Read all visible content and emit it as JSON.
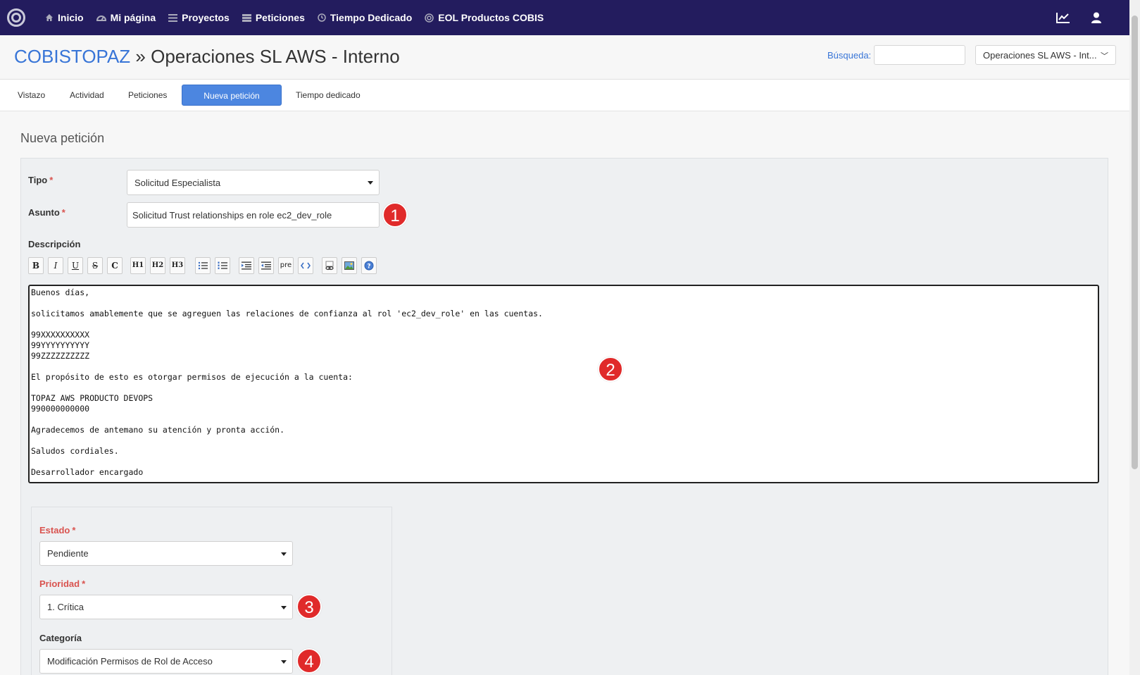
{
  "nav": {
    "items": [
      {
        "label": "Inicio",
        "icon": "home-icon"
      },
      {
        "label": "Mi página",
        "icon": "dashboard-icon"
      },
      {
        "label": "Proyectos",
        "icon": "list-icon"
      },
      {
        "label": "Peticiones",
        "icon": "issues-icon"
      },
      {
        "label": "Tiempo Dedicado",
        "icon": "clock-icon"
      },
      {
        "label": "EOL Productos COBIS",
        "icon": "globe-icon"
      }
    ]
  },
  "header": {
    "project_link": "COBISTOPAZ",
    "separator": " » ",
    "project_name": "Operaciones SL AWS - Interno",
    "search_label": "Búsqueda:",
    "search_value": "",
    "project_select": "Operaciones SL AWS - Int..."
  },
  "tabs": [
    {
      "label": "Vistazo"
    },
    {
      "label": "Actividad"
    },
    {
      "label": "Peticiones"
    },
    {
      "label": "Nueva petición",
      "active": true
    },
    {
      "label": "Tiempo dedicado"
    }
  ],
  "page": {
    "heading": "Nueva petición"
  },
  "form": {
    "tipo_label": "Tipo",
    "tipo_value": "Solicitud Especialista",
    "asunto_label": "Asunto",
    "asunto_value": "Solicitud Trust relationships en role ec2_dev_role",
    "descripcion_label": "Descripción",
    "toolbar": [
      "B",
      "I",
      "U",
      "S",
      "C",
      "H1",
      "H2",
      "H3",
      "ul",
      "ol",
      "indent",
      "outdent",
      "pre",
      "code",
      "link",
      "image",
      "help"
    ],
    "descripcion_value": "Buenos días,\n\nsolicitamos amablemente que se agreguen las relaciones de confianza al rol 'ec2_dev_role' en las cuentas.\n\n99XXXXXXXXXX\n99YYYYYYYYYY\n99ZZZZZZZZZZ\n\nEl propósito de esto es otorgar permisos de ejecución a la cuenta:\n\nTOPAZ AWS PRODUCTO DEVOPS\n990000000000\n\nAgradecemos de antemano su atención y pronta acción.\n\nSaludos cordiales.\n\nDesarrollador encargado",
    "estado_label": "Estado",
    "estado_value": "Pendiente",
    "prioridad_label": "Prioridad",
    "prioridad_value": "1. Crítica",
    "categoria_label": "Categoría",
    "categoria_value": "Modificación Permisos de Rol de Acceso",
    "required_mark": "*"
  },
  "annotations": [
    "1",
    "2",
    "3",
    "4"
  ],
  "colors": {
    "nav_bg": "#231c5e",
    "accent": "#3875d7",
    "active_tab": "#4c86e0",
    "required": "#d9534f",
    "badge": "#e02a2a"
  }
}
